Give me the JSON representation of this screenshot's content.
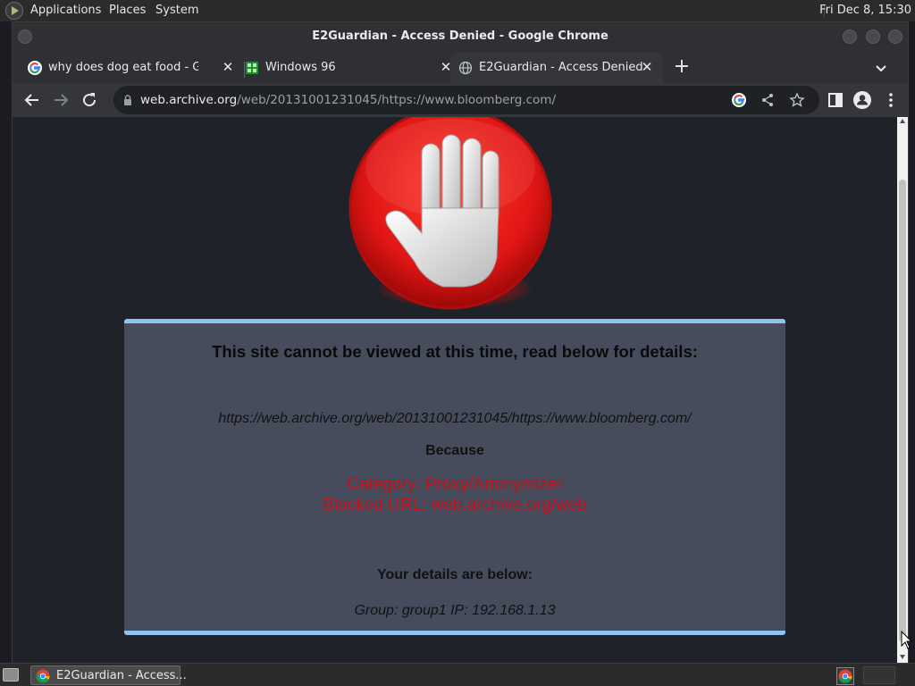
{
  "panel": {
    "menus": [
      "Applications",
      "Places",
      "System"
    ],
    "clock": "Fri Dec  8, 15:30"
  },
  "window": {
    "title": "E2Guardian - Access Denied - Google Chrome"
  },
  "tabs": [
    {
      "title": "why does dog eat food - Goog",
      "icon": "google-g-icon",
      "active": false
    },
    {
      "title": "Windows 96",
      "icon": "windows96-icon",
      "active": false
    },
    {
      "title": "E2Guardian - Access Denied",
      "icon": "globe-icon",
      "active": true
    }
  ],
  "omnibox": {
    "host": "web.archive.org",
    "path": "/web/20131001231045/https://www.bloomberg.com/"
  },
  "page": {
    "heading": "This site cannot be viewed at this time, read below for details:",
    "blocked_request_url": "https://web.archive.org/web/20131001231045/https://www.bloomberg.com/",
    "because_label": "Because",
    "category": "Category: Proxy/Anonymizer",
    "blocked_url": "Blocked URL: web.archive.org/web",
    "details_heading": "Your details are below:",
    "details_line": "Group: group1   IP: 192.168.1.13"
  },
  "taskbar": {
    "window_button": "E2Guardian - Access..."
  },
  "colors": {
    "box_background": "#464c5c",
    "box_border": "#8fc4ef",
    "warning_text": "#c8101a",
    "stop_red": "#e01515"
  }
}
